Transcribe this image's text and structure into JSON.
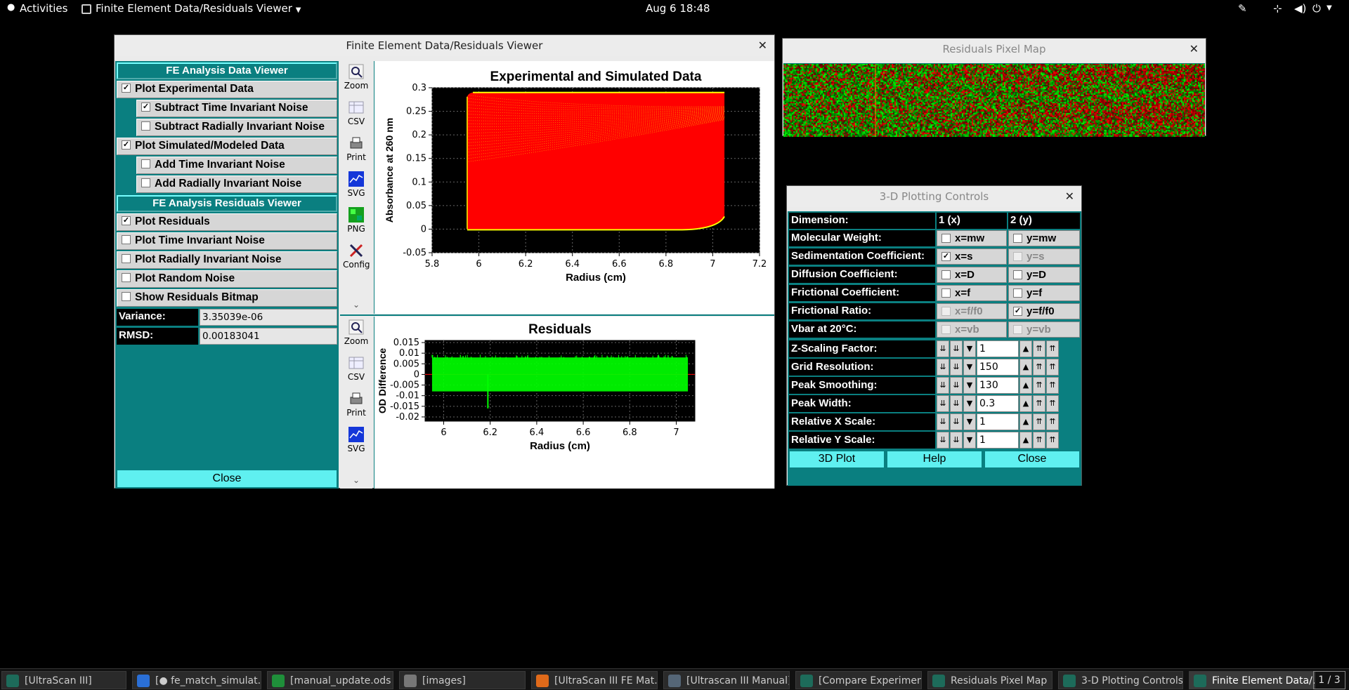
{
  "topbar": {
    "activities": "Activities",
    "app_name": "Finite Element Data/Residuals Viewer",
    "clock": "Aug 6  18:48"
  },
  "main_window": {
    "title": "Finite Element Data/Residuals Viewer",
    "left_panel": {
      "data_header": "FE Analysis Data Viewer",
      "data_items": [
        {
          "label": "Plot Experimental Data",
          "checked": true
        },
        {
          "label": "Subtract Time Invariant Noise",
          "checked": true
        },
        {
          "label": "Subtract Radially Invariant Noise",
          "checked": false
        },
        {
          "label": "Plot Simulated/Modeled Data",
          "checked": true
        },
        {
          "label": "Add Time Invariant Noise",
          "checked": false
        },
        {
          "label": "Add Radially Invariant Noise",
          "checked": false
        }
      ],
      "residuals_header": "FE Analysis Residuals Viewer",
      "residual_items": [
        {
          "label": "Plot Residuals",
          "checked": true
        },
        {
          "label": "Plot Time Invariant Noise",
          "checked": false
        },
        {
          "label": "Plot Radially Invariant Noise",
          "checked": false
        },
        {
          "label": "Plot Random Noise",
          "checked": false
        },
        {
          "label": "Show Residuals Bitmap",
          "checked": false
        }
      ],
      "variance_label": "Variance:",
      "variance_value": "3.35039e-06",
      "rmsd_label": "RMSD:",
      "rmsd_value": "0.00183041",
      "close_label": "Close"
    },
    "toolbar_top": [
      "Zoom",
      "CSV",
      "Print",
      "SVG",
      "PNG",
      "Config"
    ],
    "toolbar_bottom": [
      "Zoom",
      "CSV",
      "Print",
      "SVG"
    ],
    "check_mark": "✓",
    "more_glyph": "⌄"
  },
  "chart_data": [
    {
      "type": "scatter",
      "title": "Experimental and Simulated Data",
      "xlabel": "Radius (cm)",
      "ylabel": "Absorbance at 260 nm",
      "xlim": [
        5.8,
        7.2
      ],
      "ylim": [
        -0.05,
        0.3
      ],
      "xticks": [
        "5.8",
        "6",
        "6.2",
        "6.4",
        "6.6",
        "6.8",
        "7",
        "7.2"
      ],
      "yticks": [
        "-0.05",
        "0",
        "0.05",
        "0.1",
        "0.15",
        "0.2",
        "0.25",
        "0.3"
      ],
      "grid": true,
      "series_colors": {
        "experimental": "#ffff00",
        "simulated": "#ff0000"
      },
      "region": {
        "x_start": 5.95,
        "x_end": 7.05,
        "y_bottom": 0.0,
        "y_top": 0.29
      }
    },
    {
      "type": "scatter",
      "title": "Residuals",
      "xlabel": "Radius (cm)",
      "ylabel": "OD Difference",
      "xlim": [
        5.92,
        7.08
      ],
      "ylim": [
        -0.022,
        0.016
      ],
      "xticks": [
        "6",
        "6.2",
        "6.4",
        "6.6",
        "6.8",
        "7"
      ],
      "yticks": [
        "0.015",
        "0.01",
        "0.005",
        "0",
        "-0.005",
        "-0.01",
        "-0.015",
        "-0.02"
      ],
      "grid": true,
      "series_color": "#00ff00",
      "band": {
        "x_start": 5.95,
        "x_end": 7.05,
        "low": -0.008,
        "high": 0.008
      },
      "spike": {
        "x": 6.19,
        "low": -0.016
      }
    }
  ],
  "pixel_map_window": {
    "title": "Residuals Pixel Map"
  },
  "plot3d_window": {
    "title": "3-D Plotting Controls",
    "header": {
      "dimension": "Dimension:",
      "col1": "1 (x)",
      "col2": "2 (y)"
    },
    "rows": [
      {
        "label": "Molecular Weight:",
        "x": "x=mw",
        "x_checked": false,
        "x_enabled": true,
        "y": "y=mw",
        "y_checked": false,
        "y_enabled": true
      },
      {
        "label": "Sedimentation Coefficient:",
        "x": "x=s",
        "x_checked": true,
        "x_enabled": true,
        "y": "y=s",
        "y_checked": false,
        "y_enabled": false
      },
      {
        "label": "Diffusion Coefficient:",
        "x": "x=D",
        "x_checked": false,
        "x_enabled": true,
        "y": "y=D",
        "y_checked": false,
        "y_enabled": true
      },
      {
        "label": "Frictional Coefficient:",
        "x": "x=f",
        "x_checked": false,
        "x_enabled": true,
        "y": "y=f",
        "y_checked": false,
        "y_enabled": true
      },
      {
        "label": "Frictional Ratio:",
        "x": "x=f/f0",
        "x_checked": false,
        "x_enabled": false,
        "y": "y=f/f0",
        "y_checked": true,
        "y_enabled": true
      },
      {
        "label": "Vbar at 20°C:",
        "x": "x=vb",
        "x_checked": false,
        "x_enabled": false,
        "y": "y=vb",
        "y_checked": false,
        "y_enabled": false
      }
    ],
    "counters": [
      {
        "label": "Z-Scaling Factor:",
        "value": "1"
      },
      {
        "label": "Grid Resolution:",
        "value": "150"
      },
      {
        "label": "Peak Smoothing:",
        "value": "130"
      },
      {
        "label": "Peak Width:",
        "value": "0.3"
      },
      {
        "label": "Relative X Scale:",
        "value": "1"
      },
      {
        "label": "Relative Y Scale:",
        "value": "1"
      }
    ],
    "buttons": {
      "plot": "3D Plot",
      "help": "Help",
      "close": "Close"
    }
  },
  "taskbar": {
    "items": [
      {
        "label": "[UltraScan III]",
        "active": false,
        "color": "#1d6b5a"
      },
      {
        "label": "[● fe_match_simulat...",
        "active": false,
        "color": "#2a6fd6"
      },
      {
        "label": "[manual_update.ods ...",
        "active": false,
        "color": "#1f8f3a"
      },
      {
        "label": "[images]",
        "active": false,
        "color": "#777777"
      },
      {
        "label": "[UltraScan III FE Mat...",
        "active": false,
        "color": "#e06a1a"
      },
      {
        "label": "[Ultrascan III Manual]",
        "active": false,
        "color": "#556677"
      },
      {
        "label": "[Compare Experiment...",
        "active": false,
        "color": "#1d6b5a"
      },
      {
        "label": "Residuals Pixel Map",
        "active": false,
        "color": "#1d6b5a"
      },
      {
        "label": "3-D Plotting Controls",
        "active": false,
        "color": "#1d6b5a"
      },
      {
        "label": "Finite Element Data/...",
        "active": true,
        "color": "#1d6b5a"
      }
    ],
    "workspace": "1 / 3"
  }
}
